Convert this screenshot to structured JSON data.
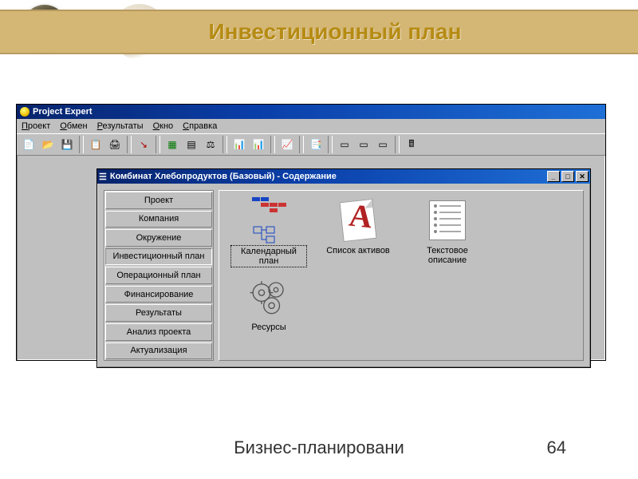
{
  "slide": {
    "title": "Инвестиционный план",
    "footer": "Бизнес-планировани",
    "page": "64"
  },
  "app": {
    "title": "Project Expert",
    "menu": [
      "Проект",
      "Обмен",
      "Результаты",
      "Окно",
      "Справка"
    ]
  },
  "child": {
    "title": "Комбинат Хлебопродуктов (Базовый) - Содержание",
    "tabs": [
      "Проект",
      "Компания",
      "Окружение",
      "Инвестиционный план",
      "Операционный план",
      "Финансирование",
      "Результаты",
      "Анализ проекта",
      "Актуализация"
    ],
    "active_tab_index": 3,
    "items": [
      {
        "label": "Календарный план",
        "selected": true
      },
      {
        "label": "Список активов",
        "selected": false
      },
      {
        "label": "Текстовое описание",
        "selected": false
      },
      {
        "label": "Ресурсы",
        "selected": false
      }
    ]
  },
  "toolbar_icons": [
    "new",
    "open",
    "save",
    "",
    "copy",
    "print",
    "",
    "exit",
    "",
    "table",
    "grid",
    "scale",
    "",
    "chart1",
    "chart2",
    "",
    "graph",
    "",
    "report",
    "",
    "win1",
    "win2",
    "win3",
    "",
    "calc"
  ]
}
